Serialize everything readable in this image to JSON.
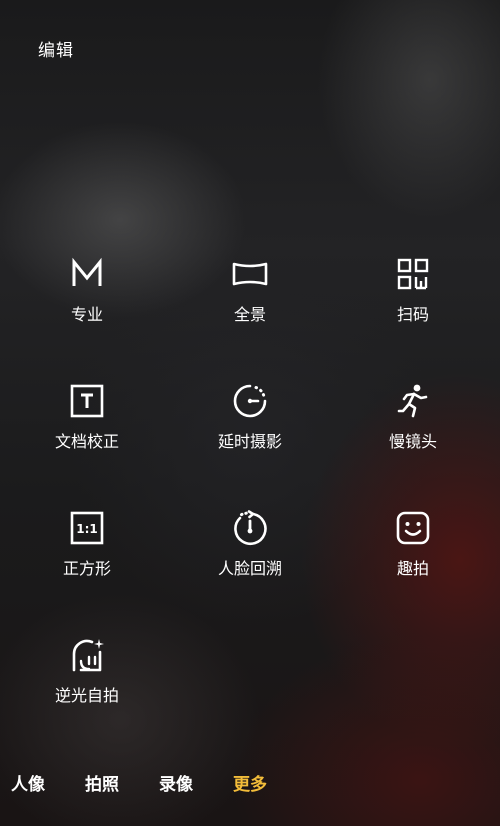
{
  "header": {
    "edit_label": "编辑"
  },
  "modes": [
    {
      "label": "专业",
      "icon": "pro-m-icon"
    },
    {
      "label": "全景",
      "icon": "panorama-icon"
    },
    {
      "label": "扫码",
      "icon": "qr-code-icon"
    },
    {
      "label": "文档校正",
      "icon": "document-correction-icon"
    },
    {
      "label": "延时摄影",
      "icon": "time-lapse-icon"
    },
    {
      "label": "慢镜头",
      "icon": "slow-motion-runner-icon"
    },
    {
      "label": "正方形",
      "icon": "square-ratio-icon"
    },
    {
      "label": "人脸回溯",
      "icon": "face-rewind-icon"
    },
    {
      "label": "趣拍",
      "icon": "fun-face-icon"
    },
    {
      "label": "逆光自拍",
      "icon": "backlight-selfie-icon"
    }
  ],
  "bottom_tabs": {
    "portrait": "人像",
    "photo": "拍照",
    "video": "录像",
    "more": "更多",
    "active": "more",
    "active_color": "#f3bd3a"
  }
}
